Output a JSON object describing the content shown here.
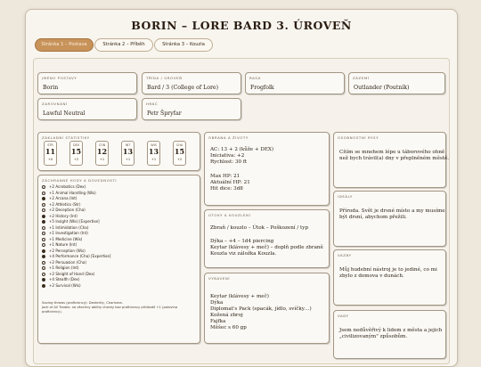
{
  "sheet": {
    "title": "BORIN – LORE BARD 3. ÚROVEŇ",
    "tabs": [
      "Stránka 1 – Postava",
      "Stránka 2 – Příběh",
      "Stránka 3 – Kouzla"
    ]
  },
  "identity": {
    "name_label": "JMÉNO POSTAVY",
    "name": "Borin",
    "class_label": "TŘÍDA / ÚROVEŇ",
    "class": "Bard / 3 (College of Lore)",
    "race_label": "RASA",
    "race": "Frogfolk",
    "background_label": "ZÁZEMÍ",
    "background": "Outlander (Poutník)",
    "alignment_label": "ZAROVNÁNÍ",
    "alignment": "Lawful Neutral",
    "player_label": "HRÁČ",
    "player": "Petr Špryťar"
  },
  "stats": {
    "label": "ZÁKLADNÍ STATISTIKY",
    "items": [
      {
        "ab": "STR",
        "score": "11",
        "mod": "+0"
      },
      {
        "ab": "DEX",
        "score": "15",
        "mod": "+2"
      },
      {
        "ab": "CON",
        "score": "12",
        "mod": "+1"
      },
      {
        "ab": "INT",
        "score": "13",
        "mod": "+1"
      },
      {
        "ab": "WIS",
        "score": "13",
        "mod": "+1"
      },
      {
        "ab": "CHA",
        "score": "15",
        "mod": "+2"
      }
    ]
  },
  "skills": {
    "label": "ZÁCHRANNÉ HODY A DOVEDNOSTI",
    "items": [
      {
        "t": "+2 Acrobatics (Dex)",
        "on": false
      },
      {
        "t": "+1 Animal Handling (Wis)",
        "on": false
      },
      {
        "t": "+2 Arcana (Int)",
        "on": true
      },
      {
        "t": "+2 Athletics (Str)",
        "on": false
      },
      {
        "t": "+2 Deception (Cha)",
        "on": false
      },
      {
        "t": "+2 History (Int)",
        "on": true
      },
      {
        "t": "+5 Insight (Wis) [Expertise]",
        "on": true
      },
      {
        "t": "+1 Intimidation (Cha)",
        "on": false
      },
      {
        "t": "+1 Investigation (Int)",
        "on": false
      },
      {
        "t": "+1 Medicine (Wis)",
        "on": false
      },
      {
        "t": "+1 Nature (Int)",
        "on": false
      },
      {
        "t": "+2 Perception (Wis)",
        "on": true
      },
      {
        "t": "+4 Performance (Cha) [Expertise]",
        "on": true
      },
      {
        "t": "+2 Persuasion (Cha)",
        "on": false
      },
      {
        "t": "+1 Religion (Int)",
        "on": false
      },
      {
        "t": "+2 Sleight of Hand (Dex)",
        "on": false
      },
      {
        "t": "+4 Stealth (Dex)",
        "on": true
      },
      {
        "t": "+2 Survival (Wis)",
        "on": true
      }
    ],
    "note1": "Saving throws (proficiency): Dexterity, Charisma.",
    "note2": "Jack of All Trades: na všechny ability checky bez proficiency přidáváš +1 (polovina",
    "note3": "proficiency)."
  },
  "combat": {
    "label": "OBRANA A ŽIVOTY",
    "ac": "AC: 13 + 2 (kůže + DEX)",
    "init": "Iniciativa: +2",
    "speed": "Rychlost: 30 ft",
    "hpmax": "Max HP: 21",
    "hpcur": "Aktuální HP: 21",
    "hitdice": "Hit dice: 3d8"
  },
  "attacks": {
    "label": "ÚTOKY A KOUZLENÍ",
    "header": "Zbraň / kouzlo – Útok – Poškození / typ",
    "line1": "Dýka – +4 – 1d4 piercing",
    "line2": "Keytar (klávesy + meč) – doplň podle zbraně",
    "line3": "Kouzla viz záložka Kouzla."
  },
  "equipment": {
    "label": "VYBAVENÍ",
    "items": [
      "Keytar (klávesy + meč)",
      "Dýka",
      "Diplomat's Pack (spacák, jídlo, svíčky…)",
      "Kožená zbroj",
      "Fajfka",
      "Měšec s 60 gp"
    ]
  },
  "traits": {
    "label": "OSOBNOSTNÍ RYSY",
    "lines": [
      "Cítím se mnohem lépe u táborového ohně",
      "než bych trávil(a) dny v přeplněném městě."
    ]
  },
  "ideals": {
    "label": "IDEÁLY",
    "lines": [
      "Příroda. Svět je drsné místo a my musíme",
      "být drsní, abychom přežili."
    ]
  },
  "bonds": {
    "label": "VAZBY",
    "lines": [
      "Můj hudební nástroj je to jediné, co mi",
      "zbylo z domova v dunách."
    ]
  },
  "flaws": {
    "label": "VADY",
    "lines": [
      "Jsem nedůvěřivý k lidem z města a jejich",
      "„civilizovaným\" způsobům."
    ]
  }
}
